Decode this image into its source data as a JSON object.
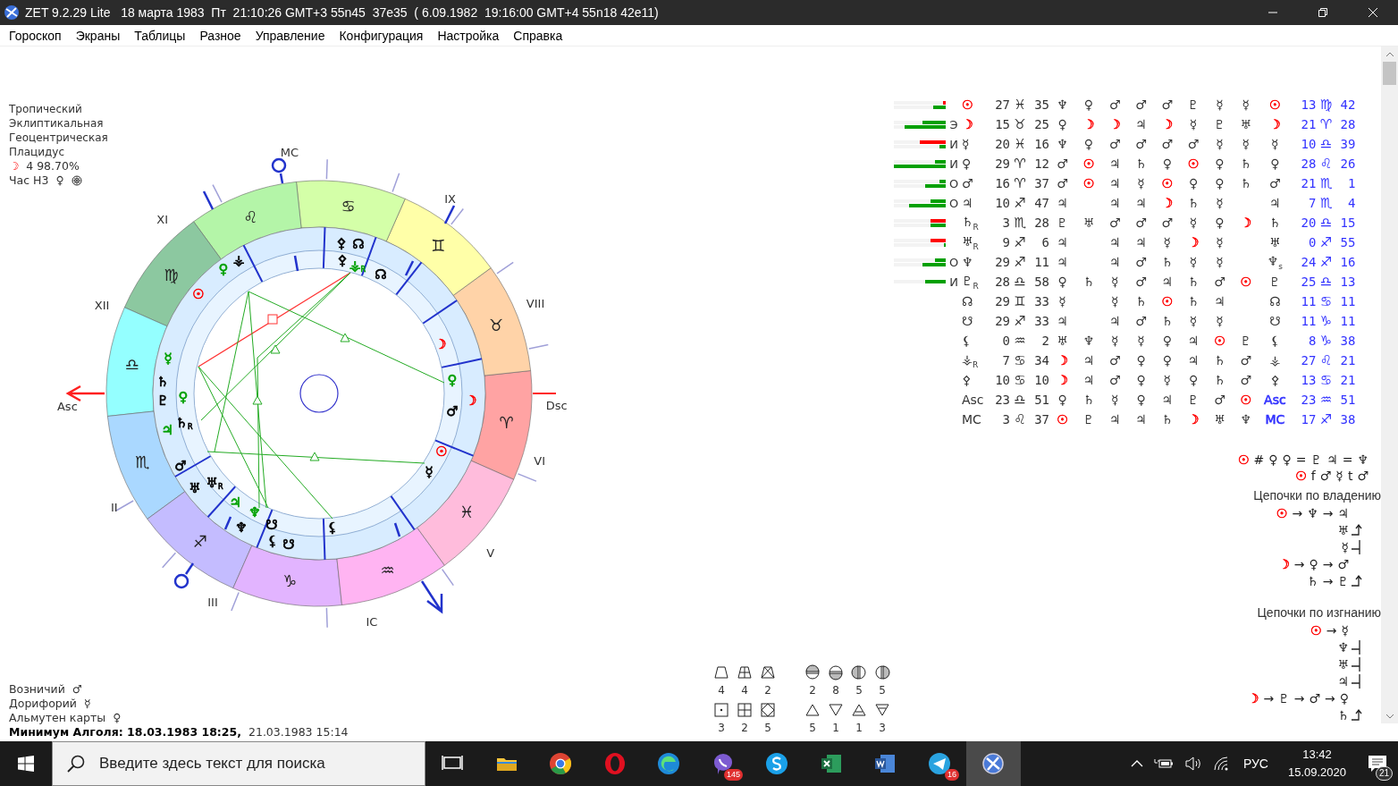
{
  "window": {
    "title": "ZET 9.2.29 Lite   18 марта 1983  Пт  21:10:26 GMT+3 55n45  37e35  ( 6.09.1982  19:16:00 GMT+4 55n18 42e11)"
  },
  "menu": [
    "Гороскоп",
    "Экраны",
    "Таблицы",
    "Разное",
    "Управление",
    "Конфигурация",
    "Настройка",
    "Справка"
  ],
  "info": {
    "lines": [
      "Тропический",
      "Эклиптикальная",
      "Геоцентрическая",
      "Плацидус"
    ],
    "moon_glyph": "☽",
    "moon_value": "4 98.70%",
    "hour_label": "Час Н3",
    "hour_glyph": "♀"
  },
  "wheel": {
    "signs": [
      {
        "glyph": "♈",
        "color": "#ffa3a3"
      },
      {
        "glyph": "♉",
        "color": "#ffd3a8"
      },
      {
        "glyph": "♊",
        "color": "#ffffa8"
      },
      {
        "glyph": "♋",
        "color": "#d4ffa8"
      },
      {
        "glyph": "♌",
        "color": "#b4f5a8"
      },
      {
        "glyph": "♍",
        "color": "#8cc8a0"
      },
      {
        "glyph": "♎",
        "color": "#94ffff"
      },
      {
        "glyph": "♏",
        "color": "#aad8ff"
      },
      {
        "glyph": "♐",
        "color": "#c4bcff"
      },
      {
        "glyph": "♑",
        "color": "#e2b4ff"
      },
      {
        "glyph": "♒",
        "color": "#ffb4f2"
      },
      {
        "glyph": "♓",
        "color": "#ffbcdc"
      }
    ],
    "houses": [
      "MC",
      "IX",
      "VIII",
      "Dsc",
      "VI",
      "V",
      "IC",
      "III",
      "II",
      "Asc",
      "XII",
      "XI"
    ],
    "planets": [
      {
        "glyph": "☉",
        "color": "#ff0000"
      },
      {
        "glyph": "♀",
        "color": "#00a000"
      },
      {
        "glyph": "⚶",
        "color": "#000000"
      },
      {
        "glyph": "☿",
        "color": "#00a000"
      },
      {
        "glyph": "♄",
        "color": "#000000"
      },
      {
        "glyph": "♇",
        "color": "#000000"
      },
      {
        "glyph": "♀",
        "color": "#00a000"
      },
      {
        "glyph": "♄",
        "color": "#000000",
        "sub": "R"
      },
      {
        "glyph": "♃",
        "color": "#00a000"
      },
      {
        "glyph": "♂",
        "color": "#000000"
      },
      {
        "glyph": "♅",
        "color": "#000000"
      },
      {
        "glyph": "♅",
        "color": "#000000",
        "sub": "R"
      },
      {
        "glyph": "♃",
        "color": "#00a000"
      },
      {
        "glyph": "♆",
        "color": "#000000"
      },
      {
        "glyph": "♆",
        "color": "#00a000"
      },
      {
        "glyph": "☋",
        "color": "#000000"
      },
      {
        "glyph": "⚸",
        "color": "#000000"
      },
      {
        "glyph": "☋",
        "color": "#000000"
      },
      {
        "glyph": "⚸",
        "color": "#000000"
      },
      {
        "glyph": "☿",
        "color": "#000000"
      },
      {
        "glyph": "☉",
        "color": "#ff0000"
      },
      {
        "glyph": "♂",
        "color": "#000000"
      },
      {
        "glyph": "☽",
        "color": "#ff0000"
      },
      {
        "glyph": "♀",
        "color": "#00a000"
      },
      {
        "glyph": "☽",
        "color": "#ff0000"
      },
      {
        "glyph": "☊",
        "color": "#000000"
      },
      {
        "glyph": "⚶",
        "color": "#00a000",
        "sub": "R"
      },
      {
        "glyph": "⚴",
        "color": "#000000"
      },
      {
        "glyph": "☊",
        "color": "#000000"
      },
      {
        "glyph": "⚴",
        "color": "#000000"
      }
    ]
  },
  "table": {
    "rows": [
      {
        "bars": [
          {
            "color": "#ff0000",
            "level": 0.05
          },
          {
            "color": "#00a000",
            "level": 0.25
          }
        ],
        "planet": {
          "glyph": "☉",
          "color": "#ff0000"
        },
        "deg": "27",
        "sign": "♓",
        "min": "35",
        "cells": [
          "♆",
          "♀",
          "♂",
          "♂",
          "♂",
          "♇",
          "☿",
          "☿"
        ],
        "marker": {
          "glyph": "☉",
          "color": "#ff0000"
        },
        "deg2": "13",
        "sign2": "♍",
        "min2": "42"
      },
      {
        "bars": [
          {
            "color": "#00a000",
            "level": 0.45
          },
          {
            "color": "#00a000",
            "level": 0.8
          }
        ],
        "dignity": "Э",
        "planet": {
          "glyph": "☽",
          "color": "#ff0000"
        },
        "deg": "15",
        "sign": "♉",
        "min": "25",
        "cells": [
          "♀",
          {
            "glyph": "☽",
            "color": "#ff0000"
          },
          {
            "glyph": "☽",
            "color": "#ff0000"
          },
          "♃",
          {
            "glyph": "☽",
            "color": "#ff0000"
          },
          "☿",
          "♇",
          "♅"
        ],
        "marker": {
          "glyph": "☽",
          "color": "#ff0000"
        },
        "deg2": "21",
        "sign2": "♈",
        "min2": "28"
      },
      {
        "bars": [
          {
            "color": "#ff0000",
            "level": 0.5
          },
          {
            "color": "#00a000",
            "level": 0.12
          }
        ],
        "dignity": "И",
        "planet": "☿",
        "deg": "20",
        "sign": "♓",
        "min": "16",
        "cells": [
          "♆",
          "♀",
          "♂",
          "♂",
          "♂",
          "♂",
          "☿",
          "☿"
        ],
        "marker": "☿",
        "deg2": "10",
        "sign2": "♎",
        "min2": "39"
      },
      {
        "bars": [
          {
            "color": "#00a000",
            "level": 0.2
          },
          {
            "color": "#00a000",
            "level": 1
          }
        ],
        "dignity": "И",
        "planet": "♀",
        "deg": "29",
        "sign": "♈",
        "min": "12",
        "cells": [
          "♂",
          {
            "glyph": "☉",
            "color": "#ff0000"
          },
          "♃",
          "♄",
          "♀",
          {
            "glyph": "☉",
            "color": "#ff0000"
          },
          "♀",
          "♄"
        ],
        "marker": "♀",
        "deg2": "28",
        "sign2": "♌",
        "min2": "26"
      },
      {
        "bars": [
          {
            "color": "#00a000",
            "level": 0.12
          },
          {
            "color": "#00a000",
            "level": 0.4
          }
        ],
        "dignity": "О",
        "planet": "♂",
        "deg": "16",
        "sign": "♈",
        "min": "37",
        "cells": [
          "♂",
          {
            "glyph": "☉",
            "color": "#ff0000"
          },
          "♃",
          "☿",
          {
            "glyph": "☉",
            "color": "#ff0000"
          },
          "♀",
          "♀",
          "♄"
        ],
        "marker": "♂",
        "deg2": "21",
        "sign2": "♏",
        "min2": "1"
      },
      {
        "bars": [
          {
            "color": "#00a000",
            "level": 0.3
          },
          {
            "color": "#00a000",
            "level": 0.7
          }
        ],
        "dignity": "О",
        "planet": "♃",
        "deg": "10",
        "sign": "♐",
        "min": "47",
        "cells": [
          "♃",
          null,
          "♃",
          "♃",
          {
            "glyph": "☽",
            "color": "#ff0000"
          },
          "♄",
          "☿",
          null
        ],
        "marker": "♃",
        "deg2": "7",
        "sign2": "♏",
        "min2": "4"
      },
      {
        "bars": [
          {
            "color": "#ff0000",
            "level": 0.3
          },
          {
            "color": "#00a000",
            "level": 0.3
          }
        ],
        "planet": "♄",
        "sub": "R",
        "deg": "3",
        "sign": "♏",
        "min": "28",
        "cells": [
          "♇",
          "♅",
          "♂",
          "♂",
          "♂",
          "☿",
          "♀",
          {
            "glyph": "☽",
            "color": "#ff0000"
          }
        ],
        "marker": "♄",
        "deg2": "20",
        "sign2": "♎",
        "min2": "15"
      },
      {
        "bars": [
          {
            "color": "#ff0000",
            "level": 0.3
          },
          {
            "color": "#00a000",
            "level": 0.04
          }
        ],
        "planet": "♅",
        "sub": "R",
        "deg": "9",
        "sign": "♐",
        "min": "6",
        "cells": [
          "♃",
          null,
          "♃",
          "♃",
          "☿",
          {
            "glyph": "☽",
            "color": "#ff0000"
          },
          "☿",
          null
        ],
        "marker": "♅",
        "deg2": "0",
        "sign2": "♐",
        "min2": "55"
      },
      {
        "bars": [
          {
            "color": "#00a000",
            "level": 0.2
          },
          {
            "color": "#00a000",
            "level": 0.45
          }
        ],
        "dignity": "О",
        "planet": "♆",
        "deg": "29",
        "sign": "♐",
        "min": "11",
        "cells": [
          "♃",
          null,
          "♃",
          "♂",
          "♄",
          "☿",
          "☿",
          null
        ],
        "marker": "♆",
        "marker_sub": "s",
        "deg2": "24",
        "sign2": "♐",
        "min2": "16"
      },
      {
        "bars": [
          {
            "color": "#00a000",
            "level": 0.4
          }
        ],
        "dignity": "И",
        "planet": "♇",
        "sub": "R",
        "deg": "28",
        "sign": "♎",
        "min": "58",
        "cells": [
          "♀",
          "♄",
          "☿",
          "♂",
          "♃",
          "♄",
          "♂",
          {
            "glyph": "☉",
            "color": "#ff0000"
          }
        ],
        "marker": "♇",
        "deg2": "25",
        "sign2": "♎",
        "min2": "13"
      },
      {
        "planet": "☊",
        "deg": "29",
        "sign": "♊",
        "min": "33",
        "cells": [
          "☿",
          null,
          "☿",
          "♄",
          {
            "glyph": "☉",
            "color": "#ff0000"
          },
          "♄",
          "♃",
          null
        ],
        "marker": "☊",
        "deg2": "11",
        "sign2": "♋",
        "min2": "11"
      },
      {
        "planet": "☋",
        "deg": "29",
        "sign": "♐",
        "min": "33",
        "cells": [
          "♃",
          null,
          "♃",
          "♂",
          "♄",
          "☿",
          "☿",
          null
        ],
        "marker": "☋",
        "deg2": "11",
        "sign2": "♑",
        "min2": "11"
      },
      {
        "planet": "⚸",
        "deg": "0",
        "sign": "♒",
        "min": "2",
        "cells": [
          "♅",
          "♆",
          "☿",
          "☿",
          "♀",
          "♃",
          {
            "glyph": "☉",
            "color": "#ff0000"
          },
          "♇"
        ],
        "marker": "⚸",
        "deg2": "8",
        "sign2": "♑",
        "min2": "38"
      },
      {
        "planet": "⚶",
        "sub": "R",
        "deg": "7",
        "sign": "♋",
        "min": "34",
        "cells": [
          {
            "glyph": "☽",
            "color": "#ff0000"
          },
          "♃",
          "♂",
          "♀",
          "♀",
          "♃",
          "♄",
          "♂"
        ],
        "marker": "⚶",
        "deg2": "27",
        "sign2": "♌",
        "min2": "21"
      },
      {
        "planet": "⚴",
        "deg": "10",
        "sign": "♋",
        "min": "10",
        "cells": [
          {
            "glyph": "☽",
            "color": "#ff0000"
          },
          "♃",
          "♂",
          "♀",
          "☿",
          "♀",
          "♄",
          "♂"
        ],
        "marker": "⚴",
        "deg2": "13",
        "sign2": "♋",
        "min2": "21"
      },
      {
        "planet": "Asc",
        "deg": "23",
        "sign": "♎",
        "min": "51",
        "cells": [
          "♀",
          "♄",
          "☿",
          "♀",
          "♃",
          "♇",
          "♂",
          {
            "glyph": "☉",
            "color": "#ff0000"
          }
        ],
        "marker": {
          "glyph": "Asc",
          "color": "#3333ff"
        },
        "deg2": "23",
        "sign2": "♒",
        "min2": "51"
      },
      {
        "planet": "MC",
        "deg": "3",
        "sign": "♌",
        "min": "37",
        "cells": [
          {
            "glyph": "☉",
            "color": "#ff0000"
          },
          "♇",
          "♃",
          "♃",
          "♄",
          {
            "glyph": "☽",
            "color": "#ff0000"
          },
          "♅",
          "♆"
        ],
        "marker": {
          "glyph": "MC",
          "color": "#3333ff"
        },
        "deg2": "17",
        "sign2": "♐",
        "min2": "38"
      }
    ]
  },
  "formulas": [
    {
      "tokens": [
        {
          "glyph": "☉",
          "color": "#ff0000"
        },
        "#",
        "♀",
        "♀",
        "=",
        "♇",
        "♃",
        "=",
        "♆"
      ]
    },
    {
      "tokens": [
        {
          "glyph": "☉",
          "color": "#ff0000"
        },
        "f",
        "♂",
        "☿",
        "t",
        "♂"
      ]
    }
  ],
  "chains": [
    {
      "title": "Цепочки по владению",
      "lines": [
        {
          "tokens": [
            {
              "glyph": "☉",
              "color": "#ff0000"
            },
            "→",
            "♆",
            "→",
            "♃"
          ]
        },
        {
          "tokens": [
            "♅"
          ],
          "hook": true
        },
        {
          "tokens": [
            "☿"
          ],
          "link": true
        },
        {
          "tokens": [
            {
              "glyph": "☽",
              "color": "#ff0000"
            },
            "→",
            "♀",
            "→",
            "♂"
          ]
        },
        {
          "tokens": [
            "♄",
            "→",
            "♇"
          ],
          "hook": true
        }
      ]
    },
    {
      "title": "Цепочки по изгнанию",
      "lines": [
        {
          "tokens": [
            {
              "glyph": "☉",
              "color": "#ff0000"
            },
            "→",
            "☿"
          ]
        },
        {
          "tokens": [
            "♆"
          ],
          "link": true
        },
        {
          "tokens": [
            "♅"
          ],
          "link": true
        },
        {
          "tokens": [
            "♃"
          ],
          "link": true
        },
        {
          "tokens": [
            {
              "glyph": "☽",
              "color": "#ff0000"
            },
            "→",
            "♇",
            "→",
            "♂",
            "→",
            "♀"
          ]
        },
        {
          "tokens": [
            "♄"
          ],
          "hook": true
        }
      ]
    }
  ],
  "rulers": [
    {
      "label": "Возничий",
      "glyph": "♂"
    },
    {
      "label": "Дорифорий",
      "glyph": "☿"
    },
    {
      "label": "Альмутен карты",
      "glyph": "♀"
    }
  ],
  "algol": {
    "label": "Минимум Алголя: 18.03.1983 18:25,",
    "next": "21.03.1983 15:14"
  },
  "stats": [
    {
      "rows": [
        [
          {
            "kind": "trapezoid",
            "value": "4"
          },
          {
            "kind": "trapezoid-cross",
            "value": "4"
          },
          {
            "kind": "trapezoid-x",
            "value": "2"
          }
        ],
        [
          {
            "kind": "square-dot",
            "value": "3"
          },
          {
            "kind": "square-cross",
            "value": "2"
          },
          {
            "kind": "square-x",
            "value": "5"
          }
        ]
      ]
    },
    {
      "rows": [
        [
          {
            "kind": "circle-top",
            "value": "2"
          },
          {
            "kind": "circle-bottom",
            "value": "8"
          },
          {
            "kind": "circle-left",
            "value": "5"
          },
          {
            "kind": "circle-right",
            "value": "5"
          }
        ],
        [
          {
            "kind": "triangle-up",
            "value": "5"
          },
          {
            "kind": "triangle-down",
            "value": "1"
          },
          {
            "kind": "triangle-up-bar",
            "value": "1"
          },
          {
            "kind": "triangle-down-bar",
            "value": "3"
          }
        ]
      ]
    }
  ],
  "taskbar": {
    "search": {
      "placeholder": "Введите здесь текст для поиска"
    },
    "apps": [
      {
        "kind": "taskview",
        "active": false
      },
      {
        "kind": "folder",
        "active": false
      },
      {
        "kind": "chrome",
        "active": false
      },
      {
        "kind": "opera",
        "active": false
      },
      {
        "kind": "edge",
        "active": false
      },
      {
        "kind": "viber",
        "active": false,
        "badge": "145"
      },
      {
        "kind": "skype",
        "active": false
      },
      {
        "kind": "excel",
        "active": false
      },
      {
        "kind": "word",
        "active": false
      },
      {
        "kind": "telegram",
        "active": false,
        "badge": "16"
      },
      {
        "kind": "zet",
        "active": true
      }
    ],
    "language": "РУС",
    "time": "13:42",
    "date": "15.09.2020",
    "notifications": "21"
  }
}
